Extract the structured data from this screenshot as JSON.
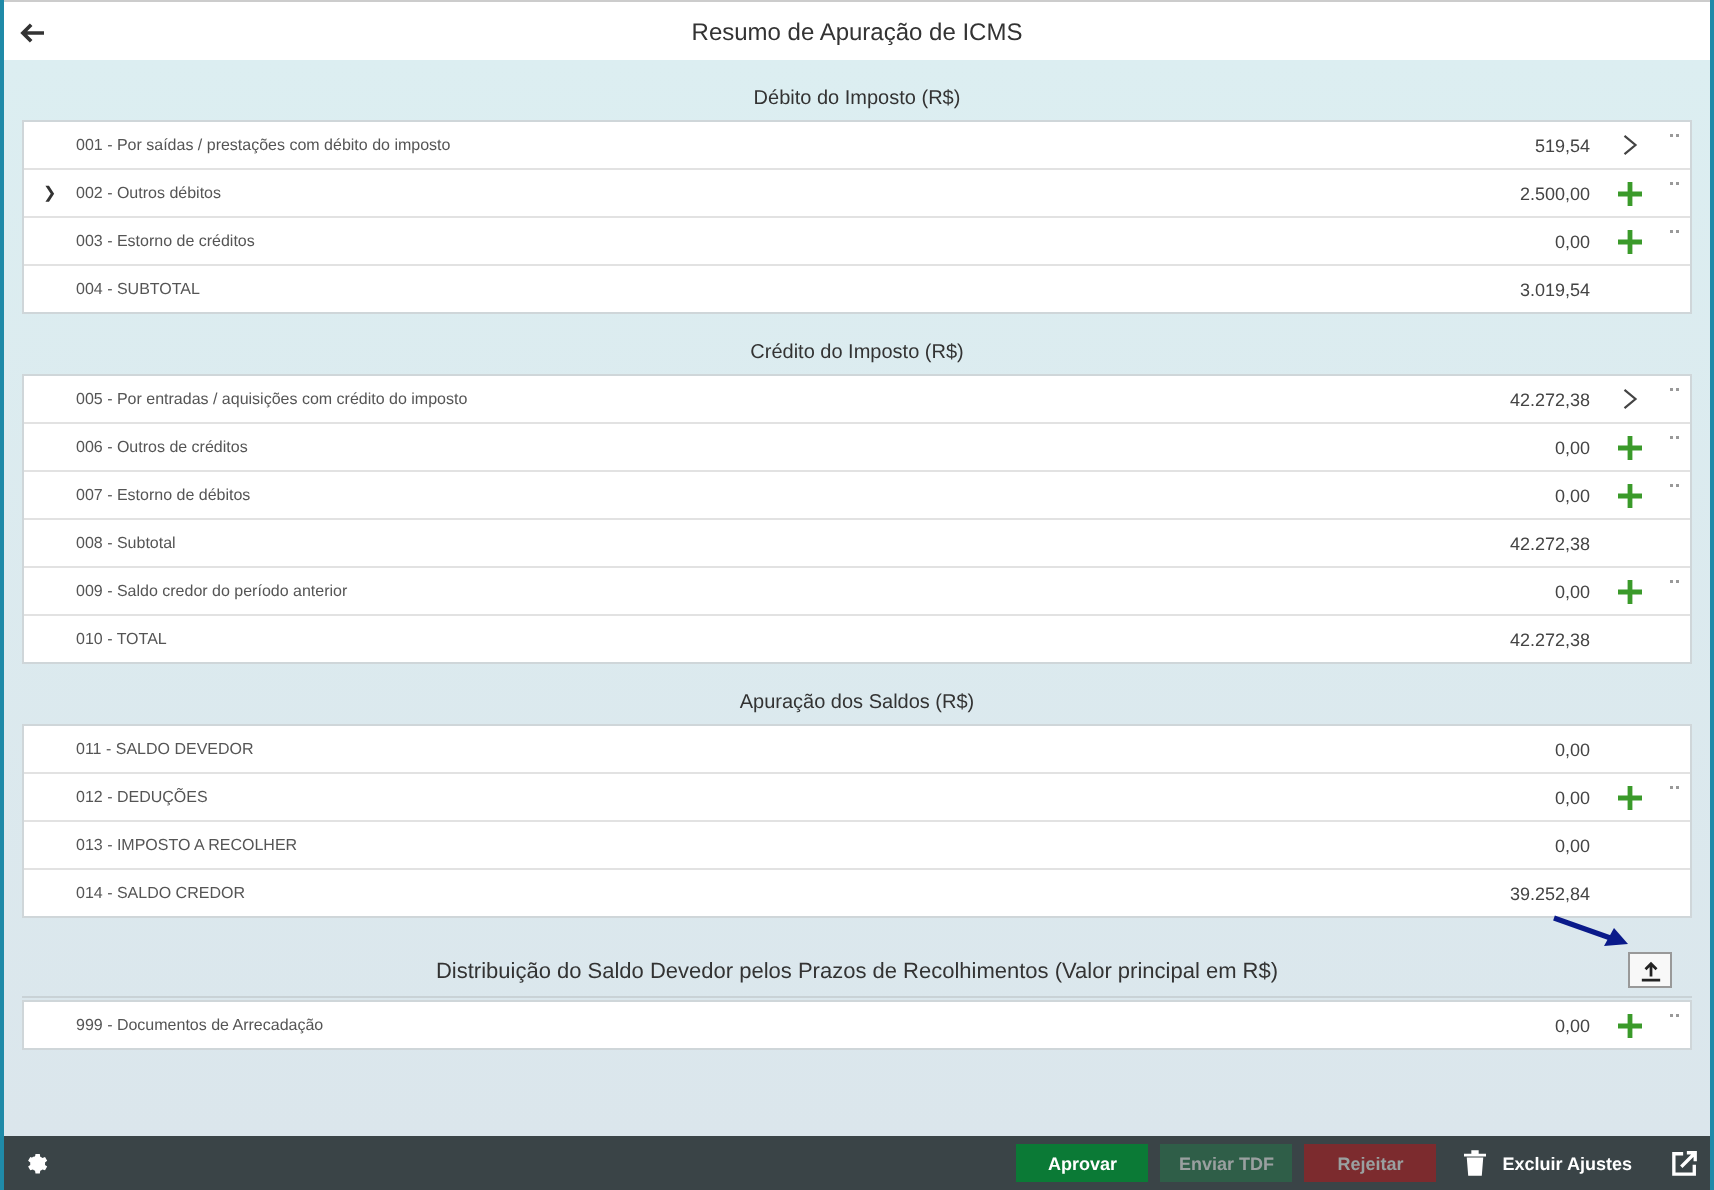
{
  "header": {
    "title": "Resumo de Apuração de ICMS"
  },
  "sections": [
    {
      "title": "Débito do Imposto (R$)",
      "rows": [
        {
          "kind": "navigate",
          "label": "001 - Por saídas / prestações com débito do imposto",
          "value": "519,54"
        },
        {
          "kind": "add",
          "marker": "❯",
          "label": "002 - Outros débitos",
          "value": "2.500,00"
        },
        {
          "kind": "add",
          "label": "003 - Estorno de créditos",
          "value": "0,00"
        },
        {
          "kind": "plain",
          "label": "004 - SUBTOTAL",
          "value": "3.019,54"
        }
      ]
    },
    {
      "title": "Crédito do Imposto (R$)",
      "rows": [
        {
          "kind": "navigate",
          "label": "005 - Por entradas / aquisições com crédito do imposto",
          "value": "42.272,38"
        },
        {
          "kind": "add",
          "label": "006 - Outros de créditos",
          "value": "0,00"
        },
        {
          "kind": "add",
          "label": "007 - Estorno de débitos",
          "value": "0,00"
        },
        {
          "kind": "plain",
          "label": "008 - Subtotal",
          "value": "42.272,38"
        },
        {
          "kind": "add",
          "label": "009 - Saldo credor do período anterior",
          "value": "0,00"
        },
        {
          "kind": "plain",
          "label": "010 - TOTAL",
          "value": "42.272,38"
        }
      ]
    },
    {
      "title": "Apuração dos Saldos (R$)",
      "rows": [
        {
          "kind": "plain",
          "label": "011 - SALDO DEVEDOR",
          "value": "0,00"
        },
        {
          "kind": "add",
          "label": "012 - DEDUÇÕES",
          "value": "0,00"
        },
        {
          "kind": "plain",
          "label": "013 - IMPOSTO A RECOLHER",
          "value": "0,00"
        },
        {
          "kind": "plain",
          "label": "014 - SALDO CREDOR",
          "value": "39.252,84"
        }
      ]
    },
    {
      "title": "Distribuição do Saldo Devedor pelos Prazos de Recolhimentos (Valor principal em R$)",
      "upload": true,
      "rows": [
        {
          "kind": "add",
          "label": "999 - Documentos de Arrecadação",
          "value": "0,00"
        }
      ]
    }
  ],
  "footer": {
    "buttons": [
      {
        "label": "Aprovar",
        "kind": "approve",
        "disabled": false
      },
      {
        "label": "Enviar TDF",
        "kind": "send",
        "disabled": true
      },
      {
        "label": "Rejeitar",
        "kind": "reject",
        "disabled": true
      }
    ],
    "delete_label": "Excluir Ajustes"
  }
}
